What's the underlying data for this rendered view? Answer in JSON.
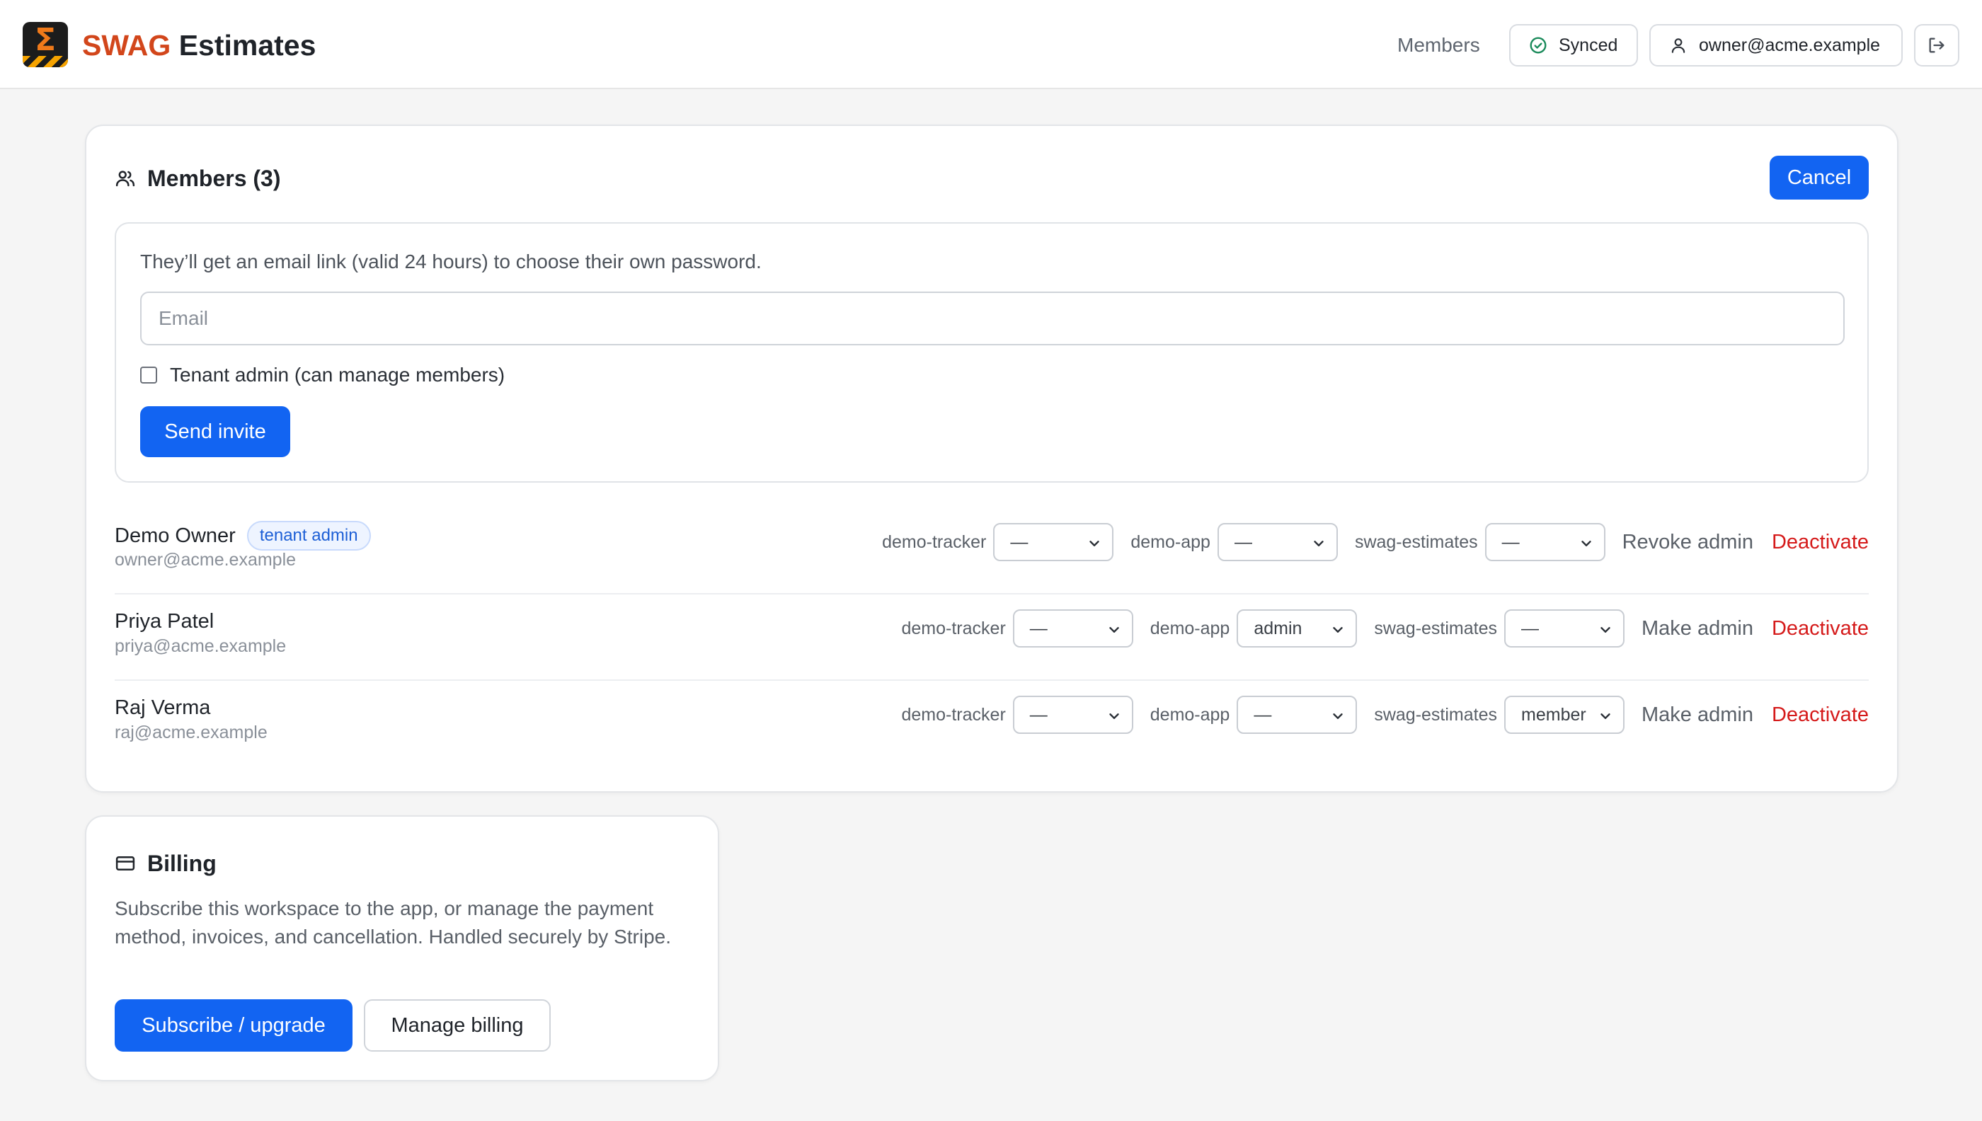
{
  "header": {
    "brand_accent": "SWAG",
    "brand_rest": " Estimates",
    "logo_glyph": "Σ",
    "nav_members": "Members",
    "sync_status": "Synced",
    "user_email": "owner@acme.example"
  },
  "members": {
    "title": "Members (3)",
    "cancel_label": "Cancel",
    "invite": {
      "hint": "They’ll get an email link (valid 24 hours) to choose their own password.",
      "email_placeholder": "Email",
      "email_value": "",
      "admin_checkbox_label": "Tenant admin (can manage members)",
      "admin_checked": false,
      "send_label": "Send invite"
    },
    "rows": [
      {
        "name": "Demo Owner",
        "badge": "tenant admin",
        "email": "owner@acme.example",
        "projects": [
          {
            "label": "demo-tracker",
            "value": "—"
          },
          {
            "label": "demo-app",
            "value": "—"
          },
          {
            "label": "swag-estimates",
            "value": "—"
          }
        ],
        "admin_action": "Revoke admin",
        "deactivate": "Deactivate"
      },
      {
        "name": "Priya Patel",
        "email": "priya@acme.example",
        "projects": [
          {
            "label": "demo-tracker",
            "value": "—"
          },
          {
            "label": "demo-app",
            "value": "admin"
          },
          {
            "label": "swag-estimates",
            "value": "—"
          }
        ],
        "admin_action": "Make admin",
        "deactivate": "Deactivate"
      },
      {
        "name": "Raj Verma",
        "email": "raj@acme.example",
        "projects": [
          {
            "label": "demo-tracker",
            "value": "—"
          },
          {
            "label": "demo-app",
            "value": "—"
          },
          {
            "label": "swag-estimates",
            "value": "member"
          }
        ],
        "admin_action": "Make admin",
        "deactivate": "Deactivate"
      }
    ]
  },
  "billing": {
    "title": "Billing",
    "description": "Subscribe this workspace to the app, or manage the payment method, invoices, and cancellation. Handled securely by Stripe.",
    "subscribe_label": "Subscribe / upgrade",
    "manage_label": "Manage billing"
  },
  "colors": {
    "primary": "#1264f2",
    "brand_accent": "#d2461b",
    "danger": "#d51a1a",
    "success": "#1a8a5a"
  },
  "icons": {
    "sync": "check-circle-icon",
    "user": "user-icon",
    "logout": "logout-icon",
    "members": "users-icon",
    "billing": "credit-card-icon",
    "select": "chevron-down-icon"
  }
}
